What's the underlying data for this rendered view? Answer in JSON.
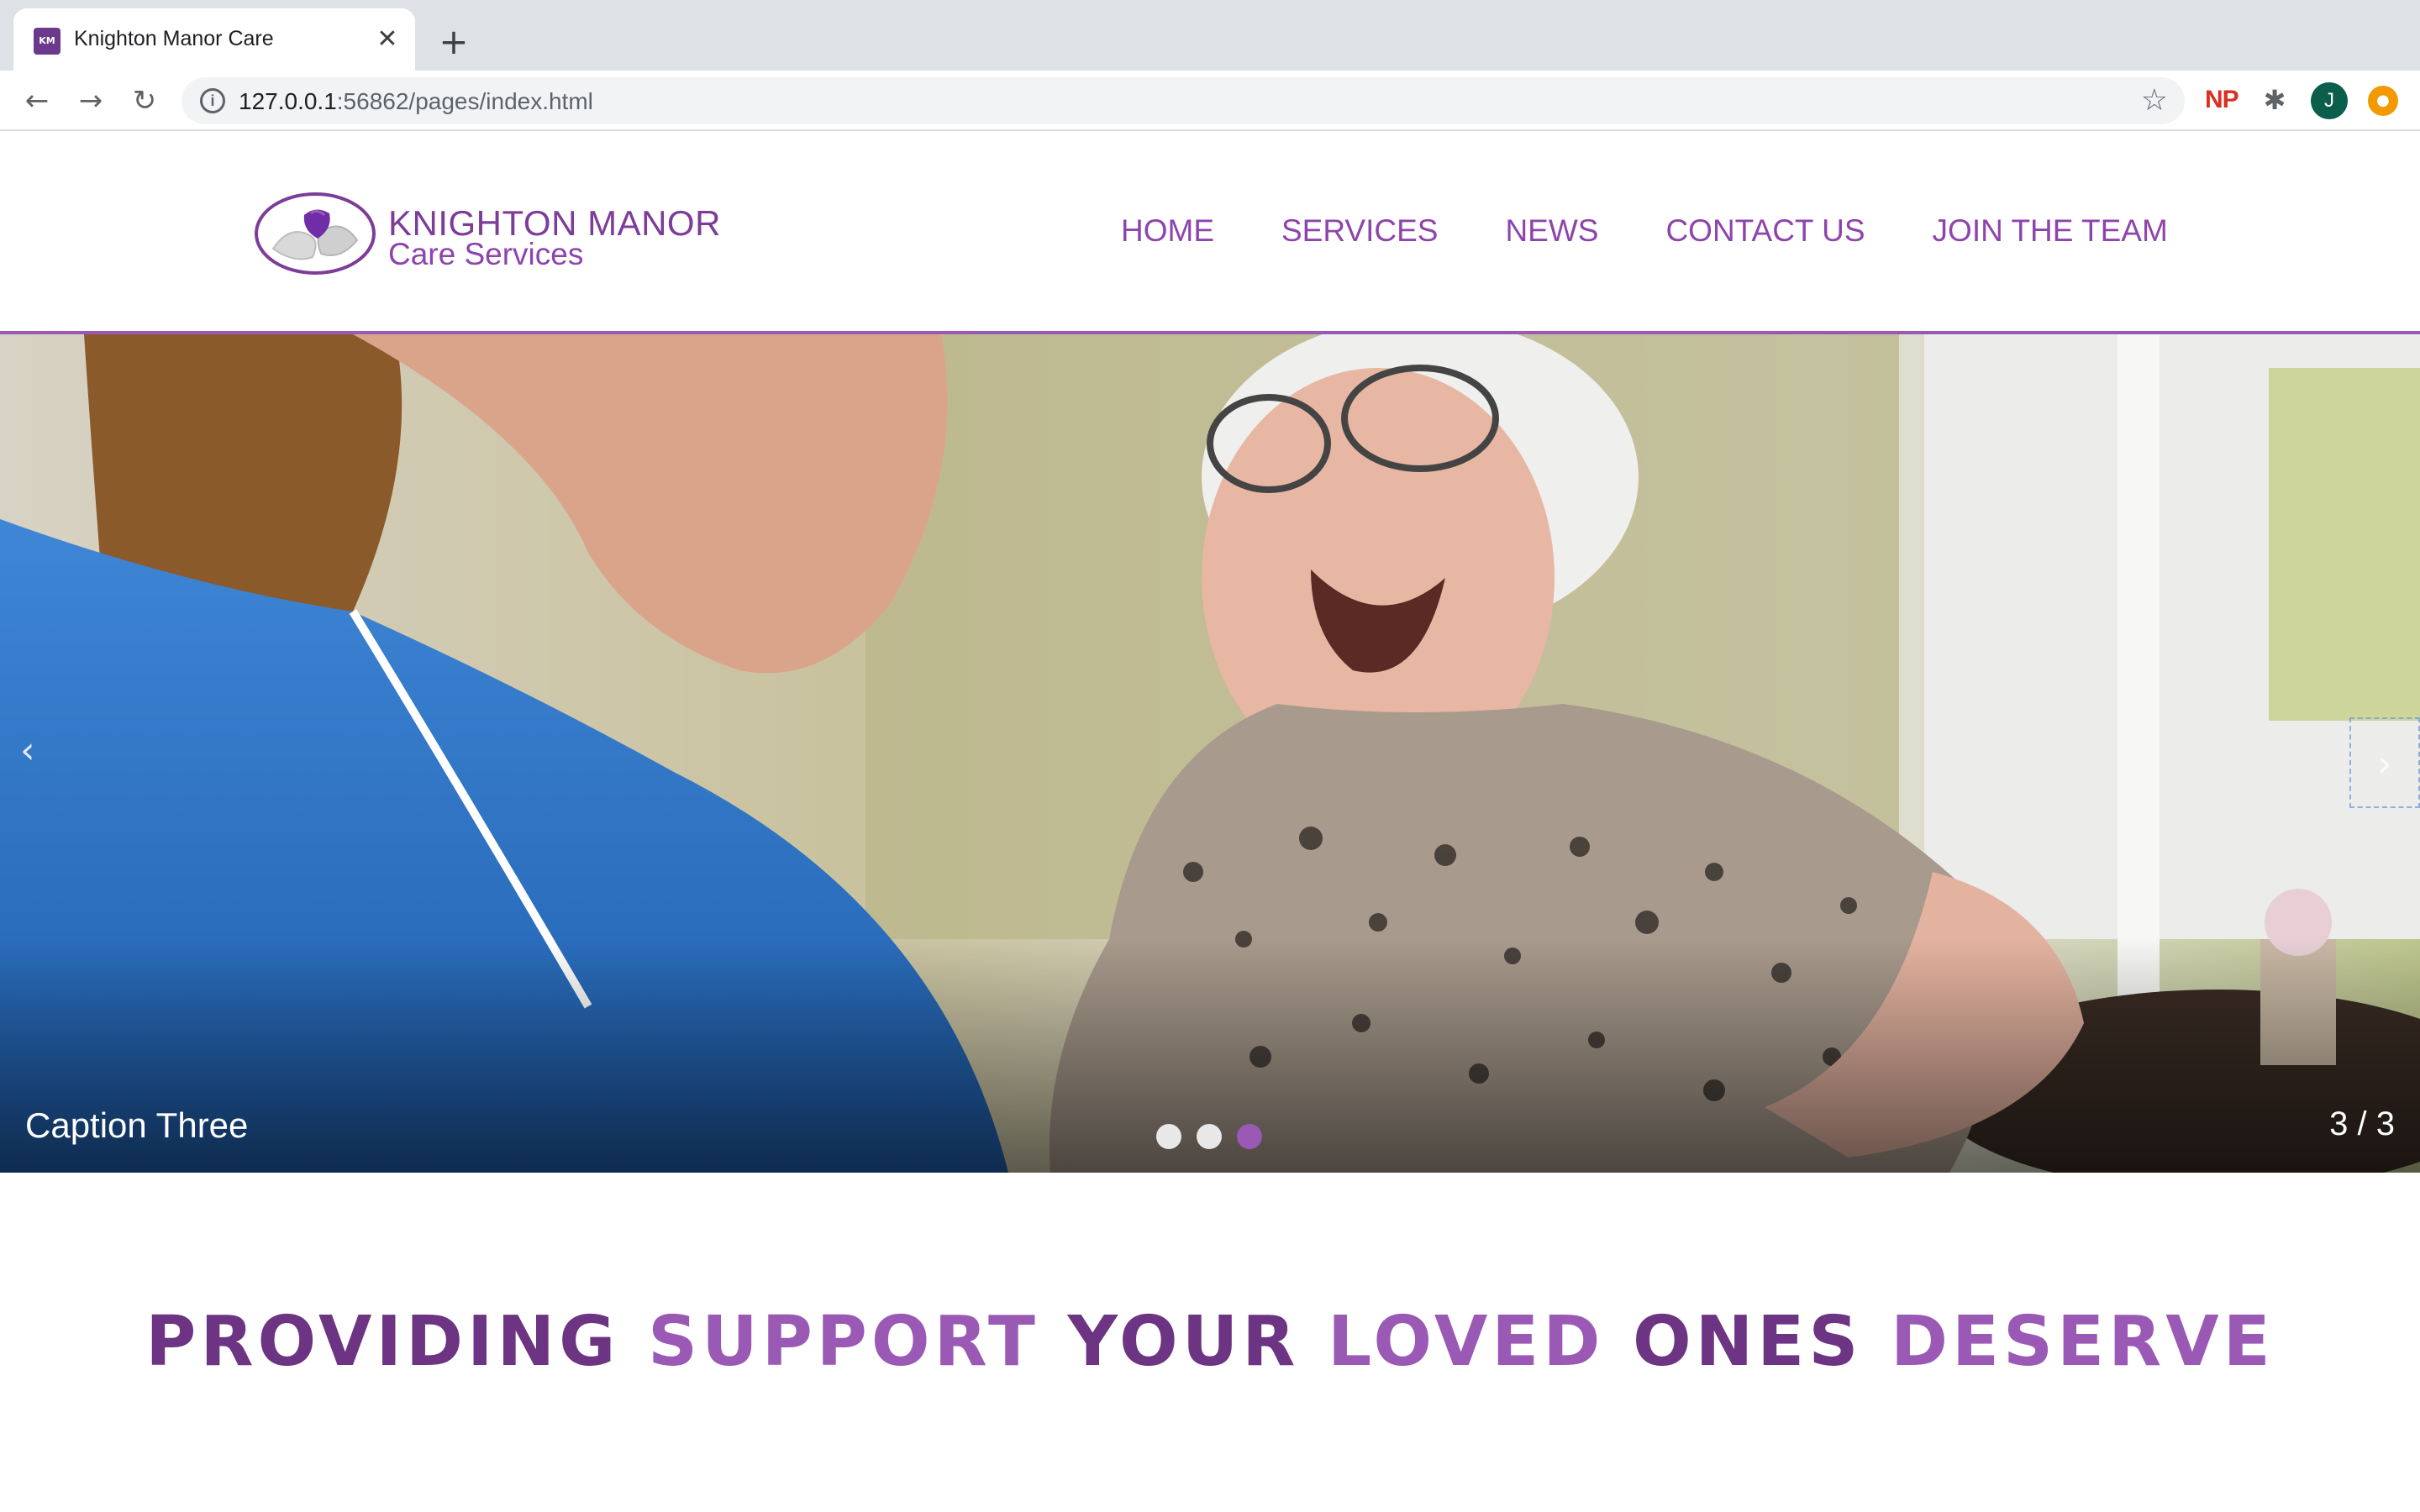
{
  "browser": {
    "tab_title": "Knighton Manor Care",
    "favicon_text": "KM",
    "close_glyph": "✕",
    "new_tab_glyph": "+",
    "url_host": "127.0.0.1",
    "url_path": ":56862/pages/index.html",
    "extension_np": "NP",
    "avatar_letter": "J"
  },
  "site": {
    "logo_title": "KNIGHTON MANOR",
    "logo_subtitle": "Care Services",
    "nav": [
      {
        "label": "HOME"
      },
      {
        "label": "SERVICES"
      },
      {
        "label": "NEWS"
      },
      {
        "label": "CONTACT US"
      },
      {
        "label": "JOIN THE TEAM"
      }
    ]
  },
  "carousel": {
    "caption": "Caption Three",
    "counter": "3 / 3",
    "slide_count": 3,
    "active_index": 2,
    "prev_glyph": "‹",
    "next_glyph": "›"
  },
  "headline": {
    "words": [
      {
        "text": "PROVIDING",
        "tone": "dark"
      },
      {
        "text": "SUPPORT",
        "tone": "light"
      },
      {
        "text": "YOUR",
        "tone": "dark"
      },
      {
        "text": "LOVED",
        "tone": "light"
      },
      {
        "text": "ONES",
        "tone": "dark"
      },
      {
        "text": "DESERVE",
        "tone": "light"
      }
    ]
  },
  "colors": {
    "brand_dark": "#6c3483",
    "brand_light": "#9b59b6",
    "nav_text": "#8e44ad"
  }
}
